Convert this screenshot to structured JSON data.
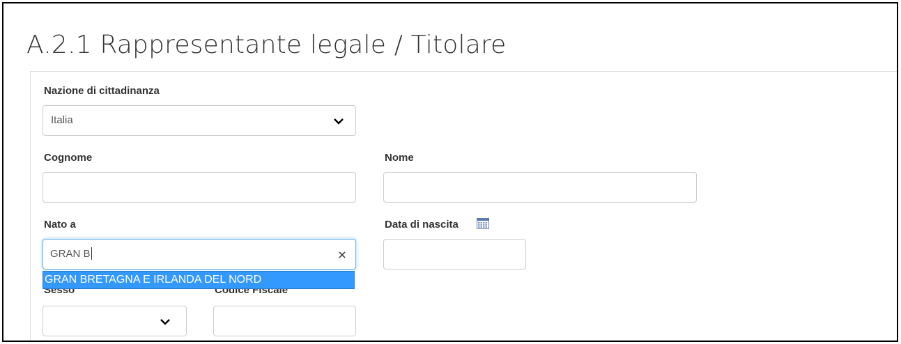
{
  "page": {
    "title": "A.2.1 Rappresentante legale / Titolare"
  },
  "form": {
    "citizenship": {
      "label": "Nazione di cittadinanza",
      "value": "Italia"
    },
    "surname": {
      "label": "Cognome",
      "value": ""
    },
    "name": {
      "label": "Nome",
      "value": ""
    },
    "birthplace": {
      "label": "Nato a",
      "value": "GRAN B",
      "suggestions": [
        "GRAN BRETAGNA E IRLANDA DEL NORD"
      ]
    },
    "birthdate": {
      "label": "Data di nascita",
      "value": "",
      "icon": "calendar-icon"
    },
    "sex": {
      "label": "Sesso",
      "value": ""
    },
    "fiscal_code": {
      "label": "Codice Fiscale",
      "value": ""
    }
  },
  "colors": {
    "highlight": "#3399ff",
    "focus_border": "#66afe9",
    "input_border": "#cccccc"
  }
}
